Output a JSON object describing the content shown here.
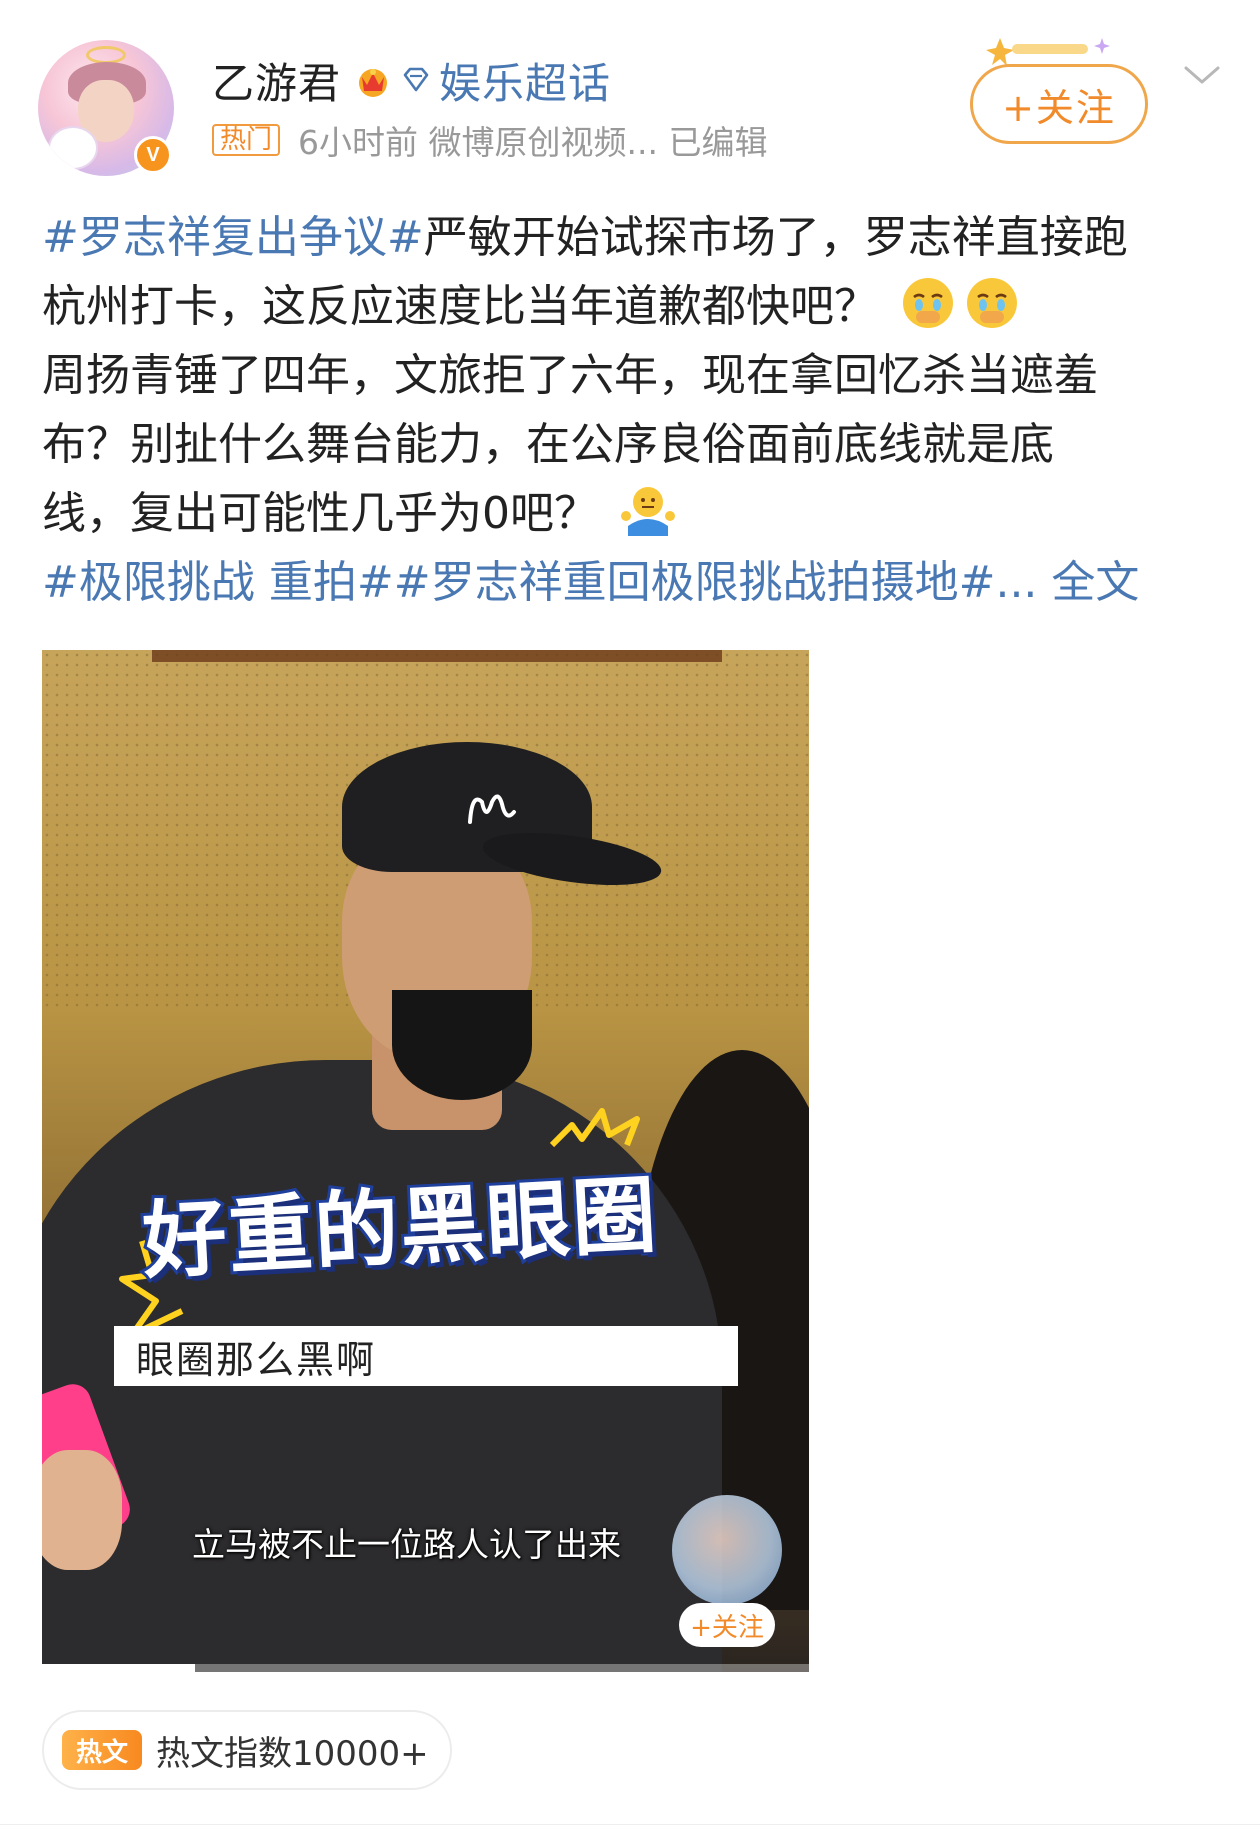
{
  "header": {
    "username": "乙游君",
    "topic_link": "娱乐超话",
    "hot_badge": "热门",
    "meta": "6小时前  微博原创视频...  已编辑",
    "follow_label": "+关注",
    "verified_mark": "V"
  },
  "post": {
    "lines": [
      {
        "hashtag": "#罗志祥复出争议#",
        "text": "严敏开始试探市场了，罗志祥直接跑"
      },
      {
        "text": "杭州打卡，这反应速度比当年道歉都快吧？"
      },
      {
        "text": "周扬青锤了四年，文旅拒了六年，现在拿回忆杀当遮羞"
      },
      {
        "text": "布？别扯什么舞台能力，在公序良俗面前底线就是底"
      },
      {
        "text": "线，复出可能性几乎为0吧？"
      }
    ],
    "tags_line": "#极限挑战 重拍##罗志祥重回极限挑战拍摄地#...",
    "full_text_link": "全文"
  },
  "video": {
    "big_caption": "好重的黑眼圈",
    "sub_caption": "眼圈那么黑啊",
    "bottom_subtitle": "立马被不止一位路人认了出来",
    "follow_label": "+关注",
    "progress": 0.2
  },
  "footer": {
    "badge": "热文",
    "index_text": "热文指数10000+"
  },
  "colors": {
    "link": "#4a78b3",
    "accent": "#f28a2a"
  },
  "icons": [
    "crown-icon",
    "diamond-icon",
    "chevron-down-icon",
    "crying-emoji-icon",
    "shrug-emoji-icon"
  ]
}
